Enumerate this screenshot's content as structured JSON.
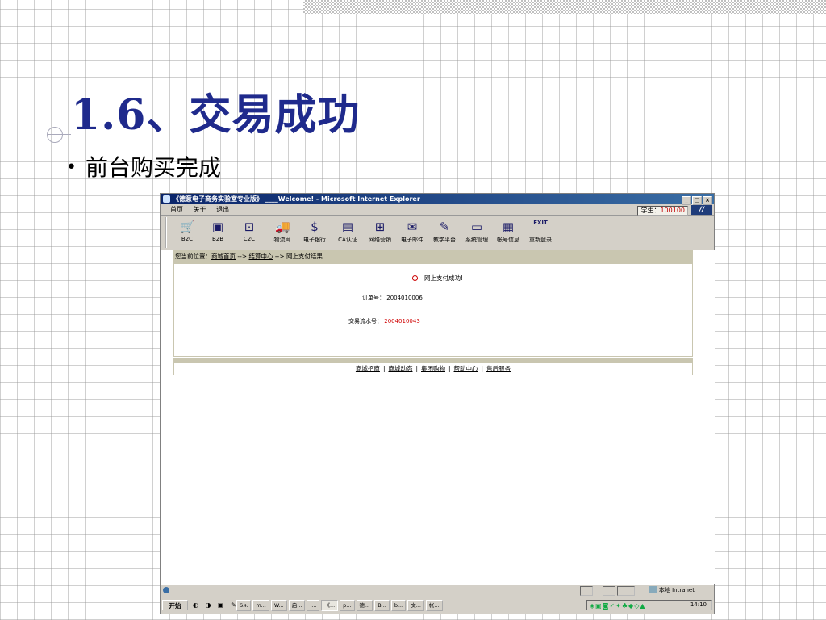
{
  "slide": {
    "title": "1.6、交易成功",
    "bullet_mark": "•",
    "bullet": "前台购买完成"
  },
  "browser": {
    "title": "《德意电子商务实验室专业版》 ____Welcome! - Microsoft Internet Explorer",
    "controls": {
      "minimize": "_",
      "maximize": "□",
      "close": "×"
    },
    "menu": [
      "首页",
      "关于",
      "退出"
    ],
    "student_label": "学生：",
    "student_id": "100100",
    "toolbar": [
      {
        "label": "B2C",
        "icon": "b2c-icon",
        "glyph": "🛒"
      },
      {
        "label": "B2B",
        "icon": "b2b-icon",
        "glyph": "▣"
      },
      {
        "label": "C2C",
        "icon": "c2c-icon",
        "glyph": "⊡"
      },
      {
        "label": "物流网",
        "icon": "truck-icon",
        "glyph": "🚚"
      },
      {
        "label": "电子银行",
        "icon": "bank-icon",
        "glyph": "$"
      },
      {
        "label": "CA认证",
        "icon": "certificate-icon",
        "glyph": "▤"
      },
      {
        "label": "网络营销",
        "icon": "network-icon",
        "glyph": "⊞"
      },
      {
        "label": "电子邮件",
        "icon": "mail-icon",
        "glyph": "✉"
      },
      {
        "label": "教学平台",
        "icon": "tools-icon",
        "glyph": "✎"
      },
      {
        "label": "系统管理",
        "icon": "computer-icon",
        "glyph": "▭"
      },
      {
        "label": "帐号信息",
        "icon": "account-icon",
        "glyph": "▦"
      },
      {
        "label": "重新登录",
        "icon": "exit-icon",
        "glyph": "EXIT"
      }
    ],
    "breadcrumb": {
      "prefix": "您当前位置：",
      "link1": "商城首页",
      "arrow": " --> ",
      "link2": "结算中心",
      "current": "网上支付结果"
    },
    "result": {
      "message": "网上支付成功!",
      "order_label": "订单号：",
      "order_no": "2004010006",
      "trade_label": "交易流水号：",
      "trade_no": "2004010043"
    },
    "footer_links": [
      "商城招商",
      "商城动态",
      "集团购物",
      "帮助中心",
      "售后服务"
    ],
    "footer_sep": "|",
    "status": {
      "zone": "本地 Intranet"
    },
    "taskbar": {
      "start": "开始",
      "quick_launch": "◐ ◑ ▣ ✎ »",
      "tasks": [
        "S...",
        "m...",
        "W...",
        "启...",
        "i...",
        "《...",
        "p...",
        "德...",
        "B...",
        "b...",
        "文...",
        "帐..."
      ],
      "active_task": 5,
      "tray_icons": "◈▣◙✓✦♣◆◇▲",
      "clock": "14:10"
    }
  },
  "colors": {
    "title_blue": "#1f2a8c",
    "titlebar": "#0a246a",
    "beige": "#c9c6b0",
    "red": "#d00000"
  }
}
